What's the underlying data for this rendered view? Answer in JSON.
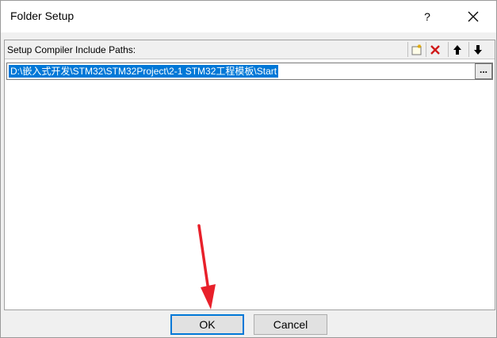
{
  "window": {
    "title": "Folder Setup",
    "help_label": "?",
    "close_icon": "close-icon"
  },
  "panel": {
    "label": "Setup Compiler Include Paths:",
    "toolbar": {
      "new_icon": "new-folder-icon",
      "delete_icon": "delete-icon",
      "move_up_icon": "arrow-up-icon",
      "move_down_icon": "arrow-down-icon"
    },
    "paths": [
      "D:\\嵌入式开发\\STM32\\STM32Project\\2-1 STM32工程模板\\Start"
    ],
    "browse_label": "..."
  },
  "footer": {
    "ok_label": "OK",
    "cancel_label": "Cancel"
  },
  "colors": {
    "selection": "#0078d7",
    "annotation_arrow": "#e8202a",
    "delete_icon": "#d01818"
  }
}
